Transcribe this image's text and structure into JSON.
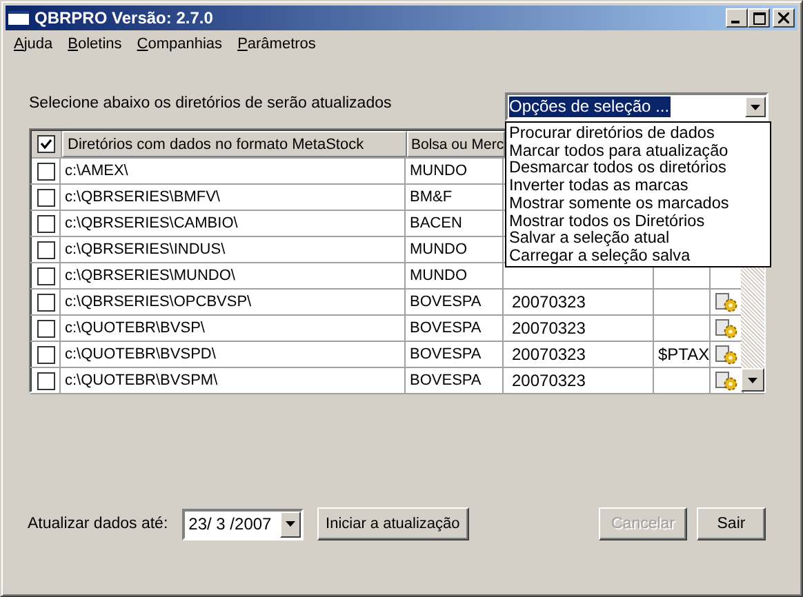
{
  "window": {
    "title": "QBRPRO Versão: 2.7.0"
  },
  "menu": [
    "Ajuda",
    "Boletins",
    "Companhias",
    "Parâmetros"
  ],
  "instruction": "Selecione abaixo os diretórios de serão atualizados",
  "selection_options": {
    "value": "Opções de seleção ...",
    "expanded": true,
    "options": [
      "Procurar diretórios de dados",
      "Marcar todos para atualização",
      "Desmarcar todos os diretórios",
      "Inverter todas as marcas",
      "Mostrar somente os marcados",
      "Mostrar todos os Diretórios",
      "Salvar a seleção atual",
      "Carregar a seleção salva"
    ]
  },
  "table": {
    "select_all_checked": true,
    "columns": [
      "Diretórios com dados no formato MetaStock",
      "Bolsa ou Merc"
    ],
    "rows": [
      {
        "checked": false,
        "directory": "c:\\AMEX\\",
        "exchange": "MUNDO"
      },
      {
        "checked": false,
        "directory": "c:\\QBRSERIES\\BMFV\\",
        "exchange": "BM&F"
      },
      {
        "checked": false,
        "directory": "c:\\QBRSERIES\\CAMBIO\\",
        "exchange": "BACEN"
      },
      {
        "checked": false,
        "directory": "c:\\QBRSERIES\\INDUS\\",
        "exchange": "MUNDO"
      },
      {
        "checked": false,
        "directory": "c:\\QBRSERIES\\MUNDO\\",
        "exchange": "MUNDO"
      },
      {
        "checked": false,
        "directory": "c:\\QBRSERIES\\OPCBVSP\\",
        "exchange": "BOVESPA",
        "column_4": "20070323"
      },
      {
        "checked": false,
        "directory": "c:\\QUOTEBR\\BVSP\\",
        "exchange": "BOVESPA",
        "column_4": "20070323"
      },
      {
        "checked": false,
        "directory": "c:\\QUOTEBR\\BVSPD\\",
        "exchange": "BOVESPA",
        "column_4": "20070323",
        "column_5": "$PTAX"
      },
      {
        "checked": false,
        "directory": "c:\\QUOTEBR\\BVSPM\\",
        "exchange": "BOVESPA",
        "column_4": "20070323"
      }
    ]
  },
  "update_until": {
    "label": "Atualizar dados até:",
    "value": "23/ 3 /2007"
  },
  "buttons": [
    {
      "label": "Iniciar a atualização",
      "disabled": false
    },
    {
      "label": "Cancelar",
      "disabled": true
    },
    {
      "label": "Sair",
      "disabled": false
    }
  ]
}
